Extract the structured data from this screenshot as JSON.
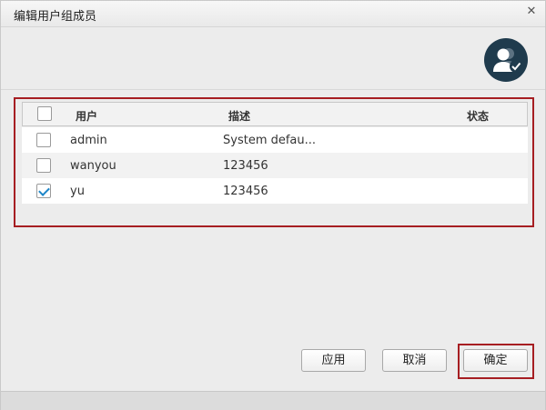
{
  "dialog": {
    "title": "编辑用户组成员",
    "close_icon": "close-icon"
  },
  "header": {
    "icon": "user-group-check-icon",
    "icon_colors": {
      "circle": "#1f3b4d",
      "glyph": "#ffffff"
    }
  },
  "table": {
    "columns": [
      "用户",
      "描述",
      "状态"
    ],
    "rows": [
      {
        "user": "admin",
        "description": "System defau...",
        "status": "",
        "checked": false
      },
      {
        "user": "wanyou",
        "description": "123456",
        "status": "",
        "checked": false
      },
      {
        "user": "yu",
        "description": "123456",
        "status": "",
        "checked": true
      }
    ],
    "select_all_checked": false
  },
  "buttons": {
    "apply": "应用",
    "cancel": "取消",
    "ok": "确定"
  },
  "colors": {
    "highlight": "#a61e22",
    "check": "#1e86c8"
  }
}
